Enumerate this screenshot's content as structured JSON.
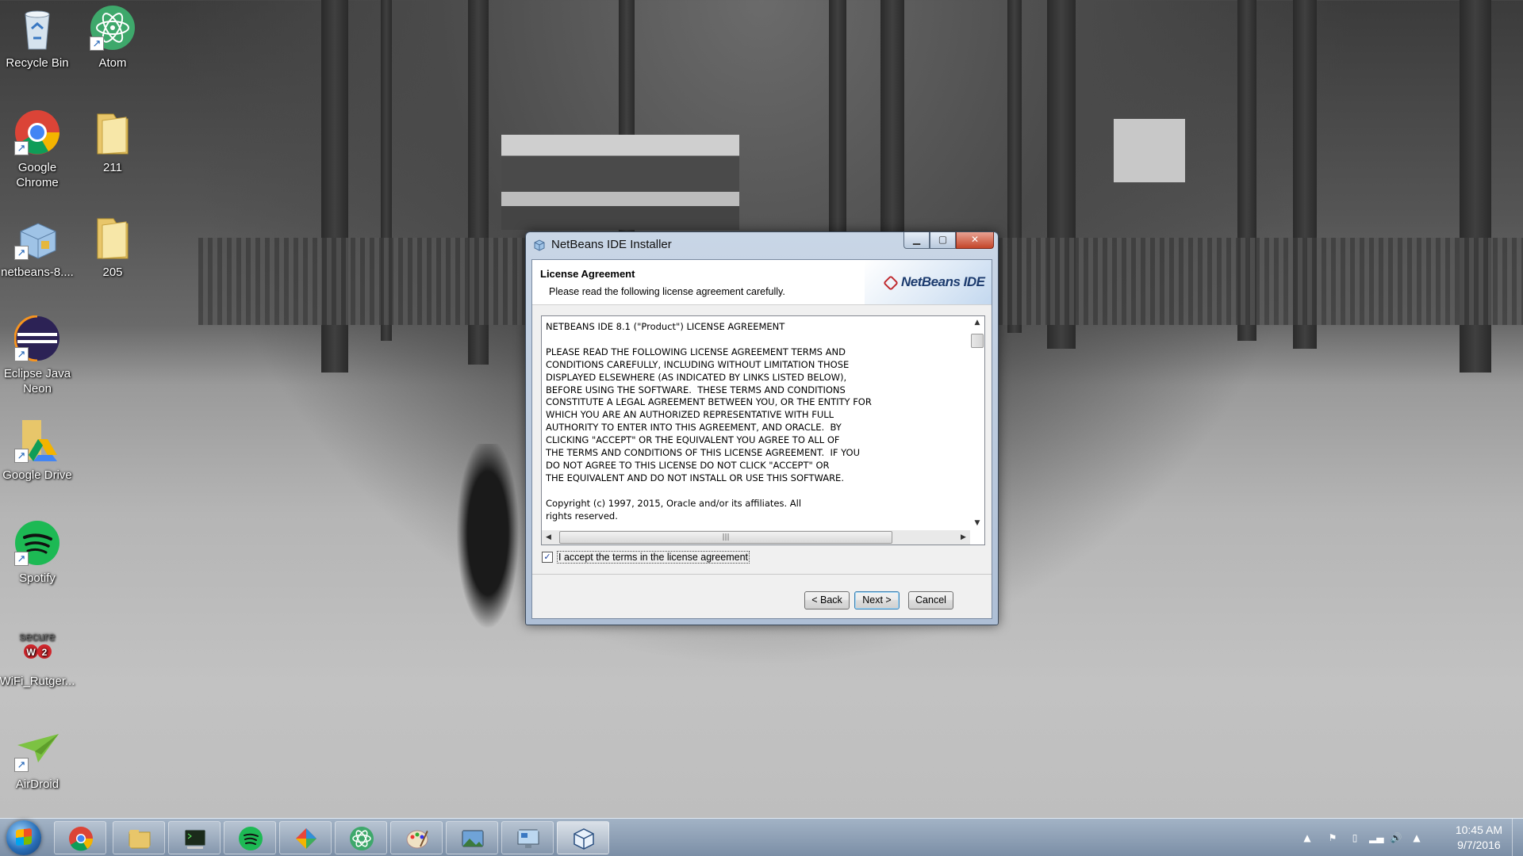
{
  "desktop": {
    "icons": [
      {
        "label": "Recycle Bin",
        "icon": "recycle-bin-icon"
      },
      {
        "label": "Atom",
        "icon": "atom-icon"
      },
      {
        "label": "Google Chrome",
        "icon": "chrome-icon"
      },
      {
        "label": "211",
        "icon": "folder-icon"
      },
      {
        "label": "netbeans-8....",
        "icon": "installer-icon"
      },
      {
        "label": "205",
        "icon": "folder-icon"
      },
      {
        "label": "Eclipse Java Neon",
        "icon": "eclipse-icon"
      },
      {
        "label": "Google Drive",
        "icon": "google-drive-icon"
      },
      {
        "label": "Spotify",
        "icon": "spotify-icon"
      },
      {
        "label": "WiFi_Rutger...",
        "icon": "securew2-icon"
      },
      {
        "label": "AirDroid",
        "icon": "airdroid-icon"
      }
    ]
  },
  "window": {
    "title": "NetBeans IDE Installer",
    "header_title": "License Agreement",
    "header_subtitle": "Please read the following license agreement carefully.",
    "logo_text": "NetBeans IDE",
    "license_text": "NETBEANS IDE 8.1 (\"Product\") LICENSE AGREEMENT\n\nPLEASE READ THE FOLLOWING LICENSE AGREEMENT TERMS AND\nCONDITIONS CAREFULLY, INCLUDING WITHOUT LIMITATION THOSE\nDISPLAYED ELSEWHERE (AS INDICATED BY LINKS LISTED BELOW),\nBEFORE USING THE SOFTWARE.  THESE TERMS AND CONDITIONS\nCONSTITUTE A LEGAL AGREEMENT BETWEEN YOU, OR THE ENTITY FOR\nWHICH YOU ARE AN AUTHORIZED REPRESENTATIVE WITH FULL\nAUTHORITY TO ENTER INTO THIS AGREEMENT, AND ORACLE.  BY\nCLICKING \"ACCEPT\" OR THE EQUIVALENT YOU AGREE TO ALL OF\nTHE TERMS AND CONDITIONS OF THIS LICENSE AGREEMENT.  IF YOU\nDO NOT AGREE TO THIS LICENSE DO NOT CLICK \"ACCEPT\" OR\nTHE EQUIVALENT AND DO NOT INSTALL OR USE THIS SOFTWARE.\n\nCopyright (c) 1997, 2015, Oracle and/or its affiliates. All\nrights reserved.",
    "accept_label": "I accept the terms in the license agreement",
    "accept_checked": true,
    "buttons": {
      "back": "< Back",
      "next": "Next >",
      "cancel": "Cancel"
    }
  },
  "taskbar": {
    "items": [
      "chrome-icon",
      "file-explorer-icon",
      "terminal-icon",
      "spotify-icon",
      "gem-app-icon",
      "atom-icon",
      "paint-icon",
      "photos-icon",
      "remote-desktop-icon",
      "netbeans-installer-icon"
    ],
    "active_item": "netbeans-installer-icon",
    "clock_time": "10:45 AM",
    "clock_date": "9/7/2016"
  },
  "colors": {
    "window_frame": "#aebfd6",
    "close_button": "#c4462a",
    "taskbar": "#8ca0b9"
  }
}
